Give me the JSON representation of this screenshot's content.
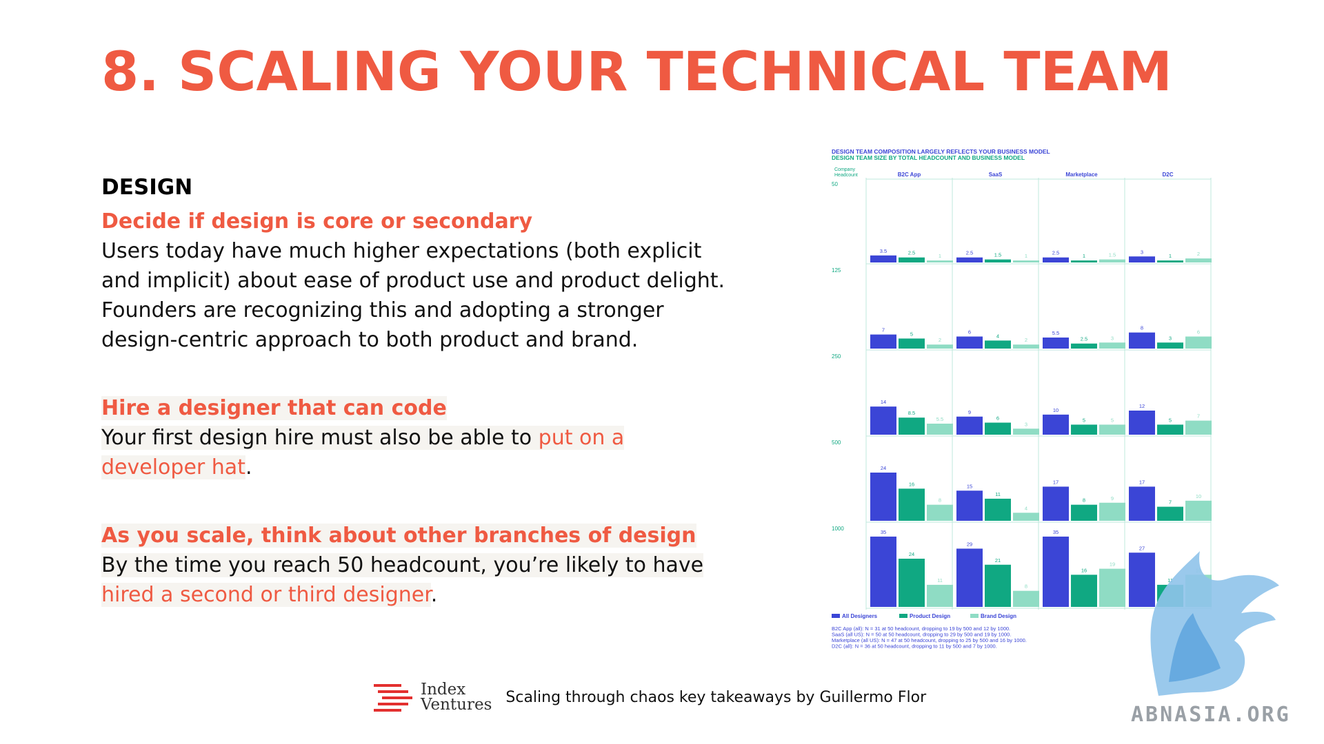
{
  "slide": {
    "title": "8. SCALING YOUR TECHNICAL TEAM",
    "section": "DESIGN",
    "blocks": [
      {
        "heading": "Decide if design is core or secondary",
        "text": "Users today have much higher expectations (both explicit and implicit) about ease of product use and product delight. Founders are recognizing this and adopting a stronger design-centric approach to both product and brand."
      },
      {
        "heading": "Hire a designer that can code",
        "text_before": "Your first design hire must also be able to ",
        "highlight": "put on a developer hat",
        "text_after": "."
      },
      {
        "heading": "As you scale, think about other branches of design",
        "text_before": "By the time you reach 50 headcount, you’re likely to have ",
        "highlight": "hired a second or third designer",
        "text_after": "."
      }
    ]
  },
  "footer": {
    "logo_line1": "Index",
    "logo_line2": "Ventures",
    "caption": "Scaling through chaos key takeaways by Guillermo Flor"
  },
  "watermark": "ABNASIA.ORG",
  "colors": {
    "accent": "#ef5a42",
    "all_designers": "#3b45d6",
    "product_design": "#10a882",
    "brand_design": "#8fdcc4"
  },
  "chart_data": {
    "type": "bar",
    "title": "DESIGN TEAM COMPOSITION LARGELY REFLECTS YOUR BUSINESS MODEL",
    "subtitle": "DESIGN TEAM SIZE BY TOTAL HEADCOUNT AND BUSINESS MODEL",
    "row_axis_label": "Company Headcount",
    "columns": [
      "B2C App",
      "SaaS",
      "Marketplace",
      "D2C"
    ],
    "rows": [
      "50",
      "125",
      "250",
      "500",
      "1000"
    ],
    "series": [
      {
        "name": "All Designers",
        "values": [
          [
            3.5,
            2.5,
            2.5,
            3
          ],
          [
            7,
            6,
            5.5,
            8
          ],
          [
            14,
            9,
            10,
            12
          ],
          [
            24,
            15,
            17,
            17
          ],
          [
            35,
            29,
            35,
            27
          ]
        ]
      },
      {
        "name": "Product Design",
        "values": [
          [
            2.5,
            1.5,
            1,
            1
          ],
          [
            5,
            4,
            2.5,
            3
          ],
          [
            8.5,
            6,
            5,
            5
          ],
          [
            16,
            11,
            8,
            7
          ],
          [
            24,
            21,
            16,
            11
          ]
        ]
      },
      {
        "name": "Brand Design",
        "values": [
          [
            1,
            1,
            1.5,
            2
          ],
          [
            2,
            2,
            3,
            6
          ],
          [
            5.5,
            3,
            5,
            7
          ],
          [
            8,
            4,
            9,
            10
          ],
          [
            11,
            8,
            19,
            16
          ]
        ]
      }
    ],
    "value_labels": [
      [
        [
          "3.5",
          "2.5",
          "1"
        ],
        [
          "2.5",
          "1.5",
          "1"
        ],
        [
          "2.5",
          "1",
          "1.5"
        ],
        [
          "3",
          "1",
          "2"
        ]
      ],
      [
        [
          "7",
          "5",
          "2"
        ],
        [
          "6",
          "4",
          "2"
        ],
        [
          "5.5",
          "2.5",
          "3"
        ],
        [
          "8",
          "3",
          "6"
        ]
      ],
      [
        [
          "14",
          "8.5",
          "5.5"
        ],
        [
          "9",
          "6",
          "3"
        ],
        [
          "10",
          "5",
          "5"
        ],
        [
          "12",
          "5",
          "7"
        ]
      ],
      [
        [
          "24",
          "16",
          "8"
        ],
        [
          "15",
          "11",
          "4"
        ],
        [
          "17",
          "8",
          "9"
        ],
        [
          "17",
          "7",
          "10"
        ]
      ],
      [
        [
          "35",
          "24",
          "11"
        ],
        [
          "29",
          "21",
          "8"
        ],
        [
          "35",
          "16",
          "19"
        ],
        [
          "27",
          "11",
          "16"
        ]
      ]
    ],
    "ylim": [
      0,
      36
    ],
    "legend": "bottom-left",
    "notes": [
      "B2C App (all): N = 31 at 50 headcount, dropping to 19 by 500 and 12 by 1000.",
      "SaaS (all US): N = 50 at 50 headcount, dropping to 29 by 500 and 19 by 1000.",
      "Marketplace (all US): N = 47 at 50 headcount, dropping to 25 by 500 and 16 by 1000.",
      "D2C (all): N = 36 at 50 headcount, dropping to 11 by 500 and 7 by 1000."
    ]
  }
}
